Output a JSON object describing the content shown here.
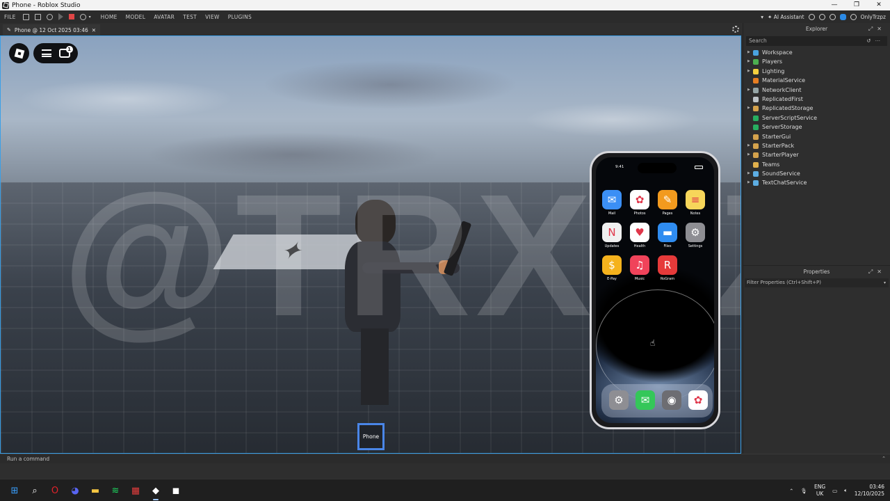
{
  "window": {
    "title": "Phone - Roblox Studio",
    "controls": [
      "—",
      "❐",
      "✕"
    ]
  },
  "menubar": {
    "file": "FILE",
    "items": [
      "HOME",
      "MODEL",
      "AVATAR",
      "TEST",
      "VIEW",
      "PLUGINS"
    ],
    "ai_assistant": "AI Assistant",
    "user": "OnlyTrzpz"
  },
  "tab": {
    "label": "Phone @ 12 Oct 2025 03:46",
    "close": "✕"
  },
  "viewport": {
    "watermark": "@TRXPZ",
    "chat_badge": "1",
    "phone_button": "Phone",
    "colors": {
      "border": "#3aa0e8",
      "phone_button_border": "#4a86e8"
    }
  },
  "phone": {
    "time": "9:41",
    "apps": [
      {
        "label": "Mail",
        "icon": "mail-icon",
        "glyph": "✉",
        "color": "#3b8ff5"
      },
      {
        "label": "Photos",
        "icon": "photos-icon",
        "glyph": "✿",
        "color": "#ffffff"
      },
      {
        "label": "Pages",
        "icon": "pages-icon",
        "glyph": "✎",
        "color": "#f29a1e"
      },
      {
        "label": "Notes",
        "icon": "notes-icon",
        "glyph": "≡",
        "color": "#f7d65a"
      },
      {
        "label": "Updates",
        "icon": "news-icon",
        "glyph": "N",
        "color": "#f0f0f0"
      },
      {
        "label": "Health",
        "icon": "health-icon",
        "glyph": "♥",
        "color": "#ffffff"
      },
      {
        "label": "Files",
        "icon": "files-icon",
        "glyph": "▬",
        "color": "#2f8cf0"
      },
      {
        "label": "Settings",
        "icon": "settings-icon",
        "glyph": "⚙",
        "color": "#8e8e93"
      },
      {
        "label": "E-Pay",
        "icon": "epay-icon",
        "glyph": "$",
        "color": "#f5b21d"
      },
      {
        "label": "Music",
        "icon": "music-icon",
        "glyph": "♫",
        "color": "#f0435a"
      },
      {
        "label": "RoGram",
        "icon": "rogram-icon",
        "glyph": "R",
        "color": "#e63a3a"
      }
    ],
    "dock": [
      {
        "icon": "settings-icon",
        "glyph": "⚙",
        "color": "#8e8e93"
      },
      {
        "icon": "messages-icon",
        "glyph": "✉",
        "color": "#34c759"
      },
      {
        "icon": "camera-icon",
        "glyph": "◉",
        "color": "#6d6d72"
      },
      {
        "icon": "photos-icon",
        "glyph": "✿",
        "color": "#ffffff"
      }
    ]
  },
  "command_bar": {
    "placeholder": "Run a command"
  },
  "explorer": {
    "title": "Explorer",
    "search_placeholder": "Search",
    "items": [
      {
        "label": "Workspace",
        "expandable": true,
        "color": "#4aa3df"
      },
      {
        "label": "Players",
        "expandable": true,
        "color": "#4caf50"
      },
      {
        "label": "Lighting",
        "expandable": true,
        "color": "#f4d03f"
      },
      {
        "label": "MaterialService",
        "expandable": false,
        "color": "#e67e22"
      },
      {
        "label": "NetworkClient",
        "expandable": true,
        "color": "#95a5a6"
      },
      {
        "label": "ReplicatedFirst",
        "expandable": false,
        "color": "#bdc3c7"
      },
      {
        "label": "ReplicatedStorage",
        "expandable": true,
        "color": "#d4a24c"
      },
      {
        "label": "ServerScriptService",
        "expandable": false,
        "color": "#27ae60"
      },
      {
        "label": "ServerStorage",
        "expandable": false,
        "color": "#27ae60"
      },
      {
        "label": "StarterGui",
        "expandable": false,
        "color": "#d4a24c"
      },
      {
        "label": "StarterPack",
        "expandable": true,
        "color": "#d4a24c"
      },
      {
        "label": "StarterPlayer",
        "expandable": true,
        "color": "#d4a24c"
      },
      {
        "label": "Teams",
        "expandable": false,
        "color": "#e0b04c"
      },
      {
        "label": "SoundService",
        "expandable": true,
        "color": "#5dade2"
      },
      {
        "label": "TextChatService",
        "expandable": true,
        "color": "#5dade2"
      }
    ]
  },
  "properties": {
    "title": "Properties",
    "filter_placeholder": "Filter Properties (Ctrl+Shift+P)"
  },
  "taskbar": {
    "apps": [
      {
        "icon": "windows-start-icon",
        "glyph": "⊞",
        "color": "#3aa0ff"
      },
      {
        "icon": "search-icon",
        "glyph": "⌕",
        "color": "#ffffff"
      },
      {
        "icon": "opera-icon",
        "glyph": "O",
        "color": "#e2222a"
      },
      {
        "icon": "discord-icon",
        "glyph": "◕",
        "color": "#5865f2"
      },
      {
        "icon": "file-explorer-icon",
        "glyph": "▬",
        "color": "#f5c542"
      },
      {
        "icon": "spotify-icon",
        "glyph": "≋",
        "color": "#1ed760"
      },
      {
        "icon": "app-icon",
        "glyph": "▦",
        "color": "#e23d3d"
      },
      {
        "icon": "roblox-studio-icon",
        "glyph": "◆",
        "color": "#ffffff"
      },
      {
        "icon": "roblox-icon",
        "glyph": "◼",
        "color": "#ffffff"
      }
    ],
    "lang_line1": "ENG",
    "lang_line2": "UK",
    "time": "03:46",
    "date": "12/10/2025"
  }
}
